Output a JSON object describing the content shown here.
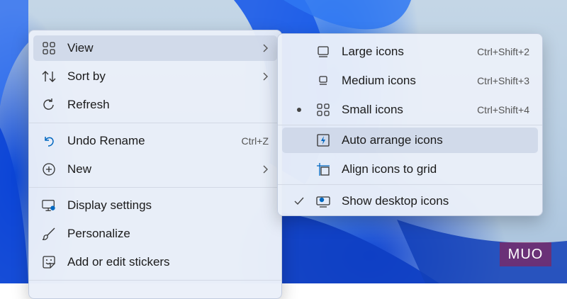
{
  "main_menu": {
    "items": [
      {
        "label": "View",
        "icon": "view-grid-icon",
        "has_submenu": true
      },
      {
        "label": "Sort by",
        "icon": "sort-icon",
        "has_submenu": true
      },
      {
        "label": "Refresh",
        "icon": "refresh-icon"
      },
      {
        "label": "Undo Rename",
        "icon": "undo-icon",
        "shortcut": "Ctrl+Z"
      },
      {
        "label": "New",
        "icon": "plus-circle-icon",
        "has_submenu": true
      },
      {
        "label": "Display settings",
        "icon": "display-icon"
      },
      {
        "label": "Personalize",
        "icon": "brush-icon"
      },
      {
        "label": "Add or edit stickers",
        "icon": "sticker-icon"
      }
    ]
  },
  "view_submenu": {
    "items": [
      {
        "label": "Large icons",
        "icon": "large-icons-icon",
        "shortcut": "Ctrl+Shift+2"
      },
      {
        "label": "Medium icons",
        "icon": "medium-icons-icon",
        "shortcut": "Ctrl+Shift+3"
      },
      {
        "label": "Small icons",
        "icon": "small-icons-icon",
        "shortcut": "Ctrl+Shift+4",
        "selected": true
      },
      {
        "label": "Auto arrange icons",
        "icon": "auto-arrange-icon"
      },
      {
        "label": "Align icons to grid",
        "icon": "align-grid-icon"
      },
      {
        "label": "Show desktop icons",
        "icon": "show-desktop-icon",
        "checked": true
      }
    ]
  },
  "watermark": {
    "text": "MUO"
  },
  "colors": {
    "accent": "#0067c0",
    "wallpaper_blue": "#1f5fe0"
  }
}
